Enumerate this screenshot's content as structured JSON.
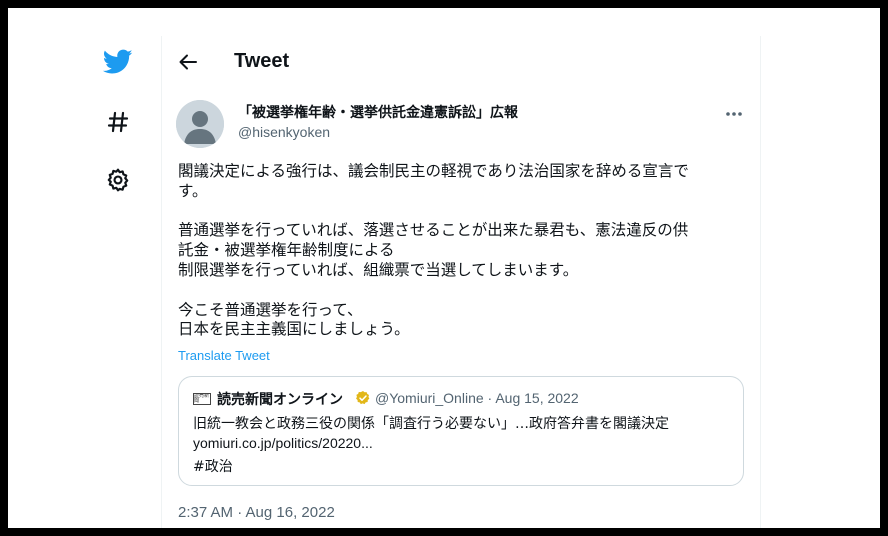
{
  "colors": {
    "accent": "#1d9bf0",
    "secondary_text": "#536471",
    "border": "#cfd9de",
    "verified_gold": "#e2b719"
  },
  "nav": {
    "items": [
      {
        "name": "twitter-logo",
        "icon": "twitter-bird-icon"
      },
      {
        "name": "explore",
        "icon": "hashtag-icon"
      },
      {
        "name": "settings",
        "icon": "gear-icon"
      }
    ]
  },
  "header": {
    "title": "Tweet",
    "back_icon": "back-arrow-icon"
  },
  "author": {
    "display_name": "「被選挙権年齢・選挙供託金違憲訴訟」広報",
    "handle": "@hisenkyoken"
  },
  "tweet": {
    "text": "閣議決定による強行は、議会制民主の軽視であり法治国家を辞める宣言で\nす。\n\n普通選挙を行っていれば、落選させることが出来た暴君も、憲法違反の供\n託金・被選挙権年齢制度による\n制限選挙を行っていれば、組織票で当選してしまいます。\n\n今こそ普通選挙を行って、\n日本を民主主義国にしましょう。",
    "translate_label": "Translate Tweet",
    "timestamp": "2:37 AM · Aug 16, 2022"
  },
  "quote": {
    "logo_text": "読売新聞",
    "name": "読売新聞オンライン",
    "handle": "@Yomiuri_Online",
    "separator": "·",
    "date": "Aug 15, 2022",
    "line1": "旧統一教会と政務三役の関係「調査行う必要ない」…政府答弁書を閣議決定",
    "line2": "yomiuri.co.jp/politics/20220...",
    "line3": "#政治"
  }
}
